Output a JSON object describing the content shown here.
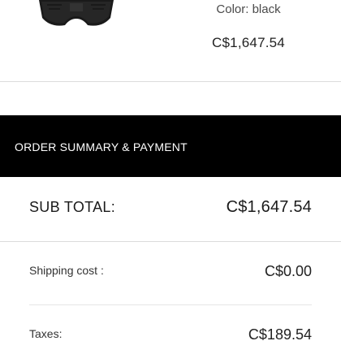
{
  "product": {
    "color_label": "Color:",
    "color_value": "black",
    "price": "C$1,647.54",
    "image_icon": "handbag-thumbnail-icon"
  },
  "summary": {
    "title": "ORDER SUMMARY & PAYMENT",
    "subtotal_label": "SUB TOTAL:",
    "subtotal_value": "C$1,647.54",
    "shipping_label": "Shipping cost :",
    "shipping_value": "C$0.00",
    "taxes_label": "Taxes:",
    "taxes_value": "C$189.54"
  },
  "colors": {
    "header_background": "#000000",
    "header_text": "#ffffff",
    "divider": "#dcdcdc"
  }
}
